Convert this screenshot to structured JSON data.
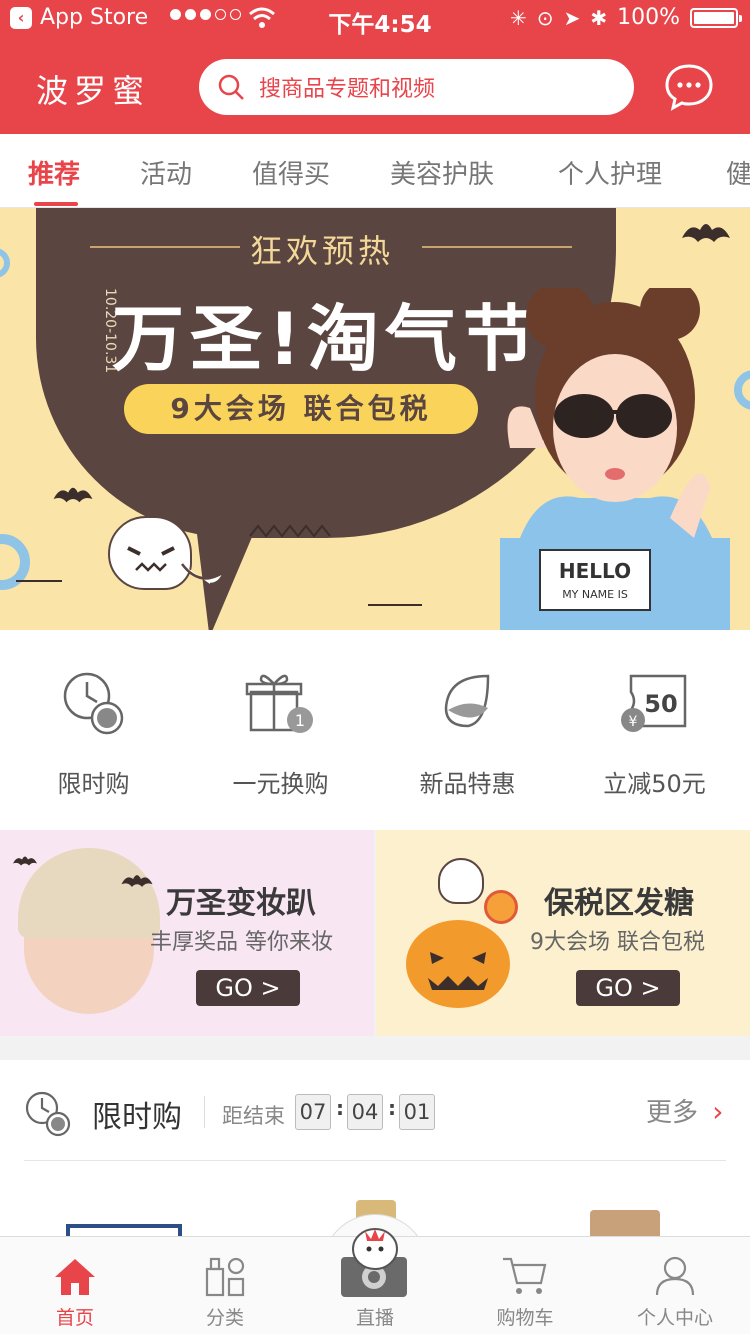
{
  "status_bar": {
    "back_app": "App Store",
    "time": "下午4:54",
    "battery": "100%",
    "battery_level": 1.0
  },
  "header": {
    "logo": "波罗蜜",
    "search_placeholder": "搜商品专题和视频",
    "icons": [
      "search-icon",
      "chat-icon"
    ]
  },
  "tabs": [
    {
      "label": "推荐",
      "active": true
    },
    {
      "label": "活动"
    },
    {
      "label": "值得买"
    },
    {
      "label": "美容护肤"
    },
    {
      "label": "个人护理"
    },
    {
      "label": "健"
    }
  ],
  "banner": {
    "subtitle": "狂欢预热",
    "title": "万圣!淘气节",
    "date": "10.20-10.31",
    "pill": "9大会场 联合包税",
    "shirt_text": "HELLO",
    "shirt_sub": "MY NAME IS"
  },
  "quick_entries": [
    {
      "label": "限时购",
      "icon": "clock-icon"
    },
    {
      "label": "一元换购",
      "icon": "gift-icon"
    },
    {
      "label": "新品特惠",
      "icon": "leaf-icon"
    },
    {
      "label": "立减50元",
      "icon": "coupon-icon",
      "badge": "50"
    }
  ],
  "promos": [
    {
      "title": "万圣变妆趴",
      "subtitle": "丰厚奖品 等你来妆",
      "button": "GO >"
    },
    {
      "title": "保税区发糖",
      "subtitle": "9大会场 联合包税",
      "button": "GO >"
    }
  ],
  "flash_sale": {
    "title": "限时购",
    "ends_label": "距结束",
    "countdown": [
      "07",
      "04",
      "01"
    ],
    "more": "更多"
  },
  "tabbar": [
    {
      "label": "首页",
      "icon": "home-icon",
      "active": true
    },
    {
      "label": "分类",
      "icon": "category-icon"
    },
    {
      "label": "直播",
      "icon": "live-icon"
    },
    {
      "label": "购物车",
      "icon": "cart-icon"
    },
    {
      "label": "个人中心",
      "icon": "person-icon"
    }
  ],
  "colors": {
    "brand_red": "#e8454b",
    "banner_bg": "#fbe4a8",
    "banner_dark": "#5a4540",
    "pill_yellow": "#fad45a"
  }
}
